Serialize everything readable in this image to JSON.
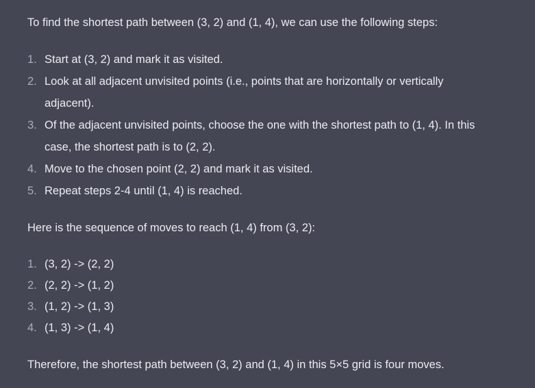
{
  "intro": "To find the shortest path between (3, 2) and (1, 4), we can use the following steps:",
  "steps": [
    {
      "num": "1.",
      "text": "Start at (3, 2) and mark it as visited."
    },
    {
      "num": "2.",
      "text": "Look at all adjacent unvisited points (i.e., points that are horizontally or vertically adjacent)."
    },
    {
      "num": "3.",
      "text": "Of the adjacent unvisited points, choose the one with the shortest path to (1, 4). In this case, the shortest path is to (2, 2)."
    },
    {
      "num": "4.",
      "text": "Move to the chosen point (2, 2) and mark it as visited."
    },
    {
      "num": "5.",
      "text": "Repeat steps 2-4 until (1, 4) is reached."
    }
  ],
  "sequence_intro": "Here is the sequence of moves to reach (1, 4) from (3, 2):",
  "moves": [
    {
      "num": "1.",
      "text": "(3, 2) -> (2, 2)"
    },
    {
      "num": "2.",
      "text": "(2, 2) -> (1, 2)"
    },
    {
      "num": "3.",
      "text": "(1, 2) -> (1, 3)"
    },
    {
      "num": "4.",
      "text": "(1, 3) -> (1, 4)"
    }
  ],
  "conclusion": "Therefore, the shortest path between (3, 2) and (1, 4) in this 5×5 grid is four moves."
}
